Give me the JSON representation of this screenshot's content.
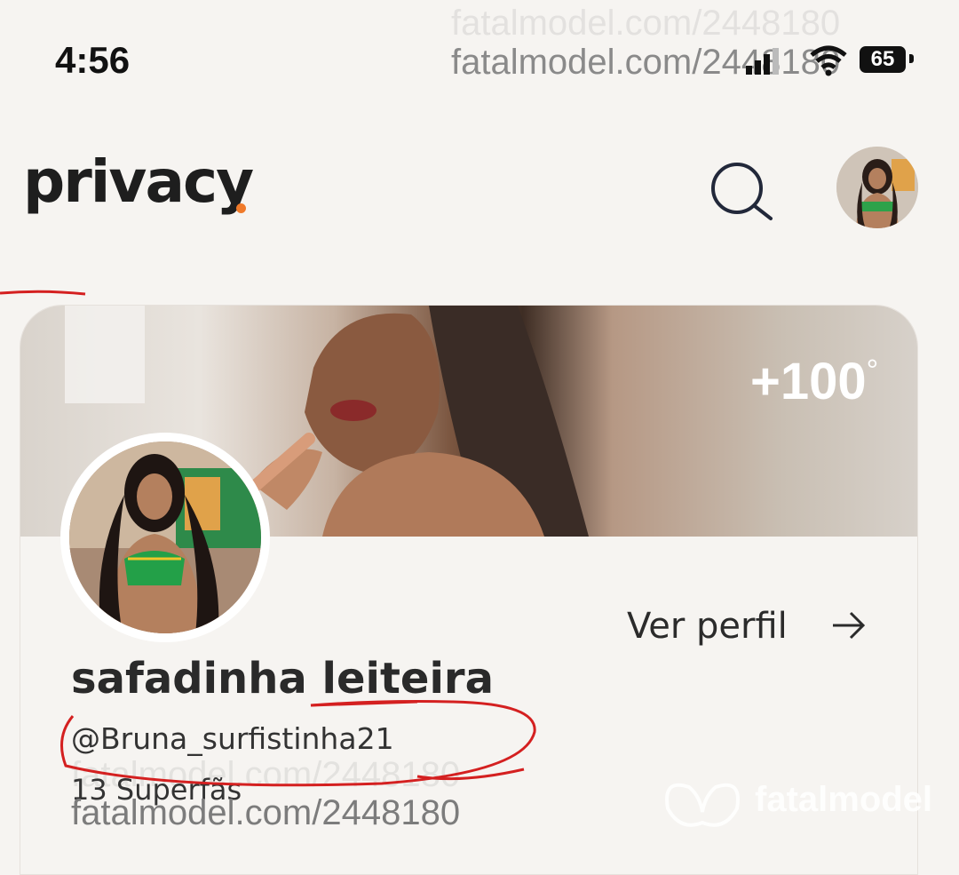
{
  "status_bar": {
    "time": "4:56",
    "url_watermark": "fatalmodel.com/2448180",
    "battery": "65"
  },
  "header": {
    "logo": "privacy",
    "logo_accent_color": "#f07a2a",
    "search_icon": "search-icon"
  },
  "profile": {
    "cover_stat": "+100",
    "cover_stat_symbol": "°",
    "view_profile_label": "Ver perfil",
    "name": "safadinha leiteira",
    "handle": "@Bruna_surfistinha21",
    "fans": "13 Superfãs"
  },
  "watermarks": {
    "site": "fatalmodel.com/2448180",
    "brand": "fatalmodel"
  },
  "annotation_color": "#d42020"
}
